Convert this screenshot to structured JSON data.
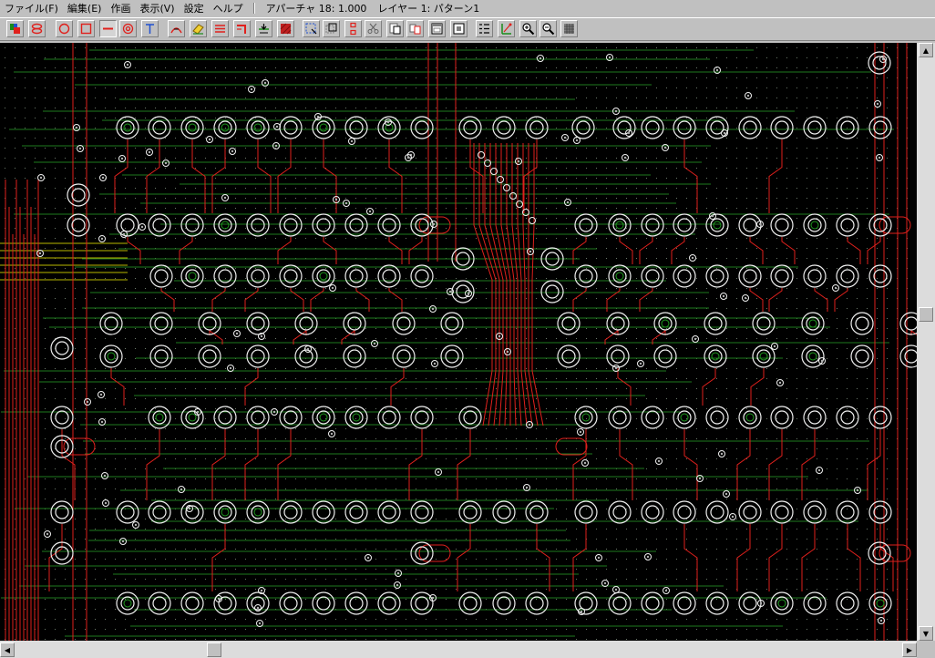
{
  "menu": {
    "file": "ファイル(F)",
    "edit": "編集(E)",
    "draw": "作画",
    "view": "表示(V)",
    "settings": "設定",
    "help": "ヘルプ"
  },
  "status": {
    "aperture": "アパーチャ 18: 1.000",
    "layer": "レイヤー 1: パターン1"
  },
  "toolbar": {
    "buttons": [
      {
        "name": "layer-color-tool",
        "icon": "layer-color-icon"
      },
      {
        "name": "layer-set-tool",
        "icon": "layer-stack-icon"
      },
      {
        "name": "circle-tool",
        "icon": "circle-icon"
      },
      {
        "name": "rectangle-tool",
        "icon": "rectangle-icon"
      },
      {
        "name": "line-tool",
        "icon": "line-icon",
        "pressed": true
      },
      {
        "name": "pad-tool",
        "icon": "pad-icon"
      },
      {
        "name": "text-tool",
        "icon": "text-icon"
      },
      {
        "name": "arc-tool",
        "icon": "arc-icon"
      },
      {
        "name": "eraser-tool",
        "icon": "eraser-icon"
      },
      {
        "name": "parallel-line-tool",
        "icon": "parallel-lines-icon"
      },
      {
        "name": "corner-trace-tool",
        "icon": "corner-trace-icon"
      },
      {
        "name": "align-tool",
        "icon": "align-icon"
      },
      {
        "name": "fill-tool",
        "icon": "hatch-fill-icon"
      },
      {
        "name": "select-tool",
        "icon": "select-icon"
      },
      {
        "name": "move-tool",
        "icon": "move-icon"
      },
      {
        "name": "copy-tool",
        "icon": "copy-icon"
      },
      {
        "name": "cut-tool",
        "icon": "scissors-icon"
      },
      {
        "name": "paste-tool",
        "icon": "paste-icon"
      },
      {
        "name": "duplicate-tool",
        "icon": "duplicate-icon"
      },
      {
        "name": "window-tool",
        "icon": "window-icon"
      },
      {
        "name": "frame-tool",
        "icon": "frame-icon"
      },
      {
        "name": "grid-list-tool",
        "icon": "grid-list-icon"
      },
      {
        "name": "measure-tool",
        "icon": "measure-icon"
      },
      {
        "name": "zoom-in-tool",
        "icon": "zoom-in-icon"
      },
      {
        "name": "zoom-out-tool",
        "icon": "zoom-out-icon"
      },
      {
        "name": "grid-tool",
        "icon": "grid-icon"
      }
    ]
  },
  "colors": {
    "background": "#000000",
    "trace": "#e0201c",
    "trace_green": "#1e7a1e",
    "pad": "#f0f0f0",
    "pad_ring_green": "#1e9a1e",
    "grid_dot": "#6a7a6a",
    "trace_yellow": "#b8b800"
  },
  "scroll": {
    "vertical_position": 0.45,
    "horizontal_position": 0.22
  }
}
